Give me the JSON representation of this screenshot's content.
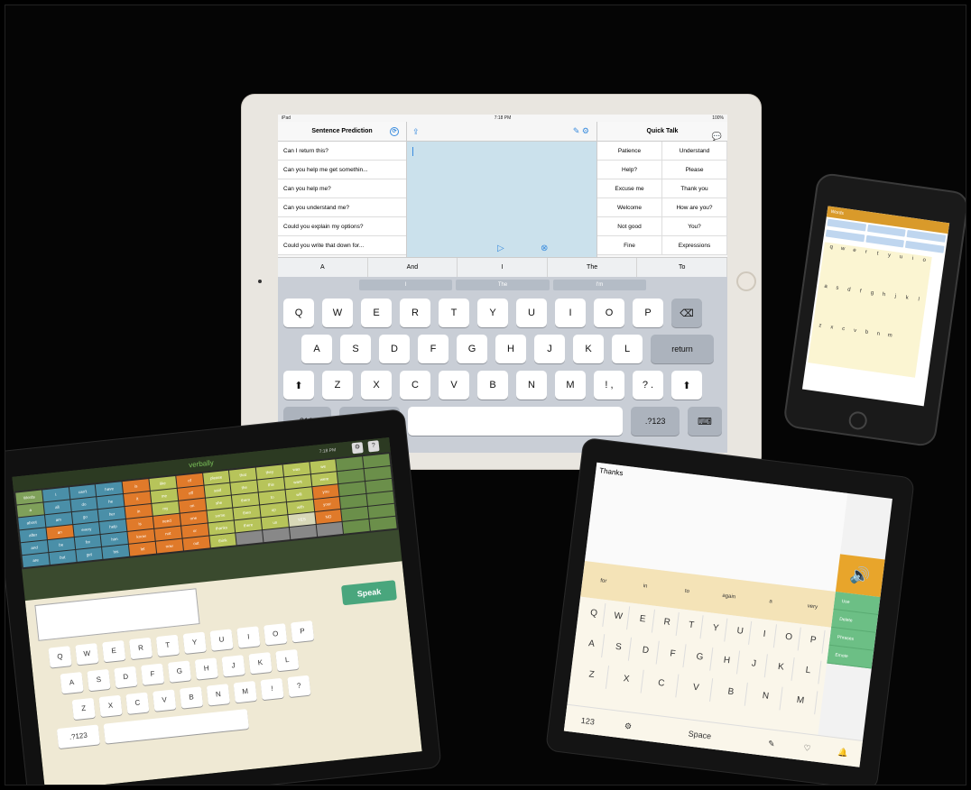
{
  "ipad": {
    "status": {
      "left": "iPad",
      "time": "7:18 PM",
      "battery": "100%"
    },
    "left_panel": {
      "title": "Sentence Prediction",
      "rows": [
        "Can I return this?",
        "Can you help me get somethin...",
        "Can you help me?",
        "Can you understand me?",
        "Could you explain my options?",
        "Could you write that down for..."
      ]
    },
    "right_panel": {
      "title": "Quick Talk",
      "cells": [
        "Patience",
        "Understand",
        "Help?",
        "Please",
        "Excuse me",
        "Thank you",
        "Welcome",
        "How are you?",
        "Not good",
        "You?",
        "Fine",
        "Expressions"
      ]
    },
    "prediction_bar": [
      "A",
      "And",
      "I",
      "The",
      "To"
    ],
    "suggestions": [
      "I",
      "The",
      "I'm"
    ],
    "keyboard": {
      "row1": [
        "Q",
        "W",
        "E",
        "R",
        "T",
        "Y",
        "U",
        "I",
        "O",
        "P"
      ],
      "row2": [
        "A",
        "S",
        "D",
        "F",
        "G",
        "H",
        "J",
        "K",
        "L"
      ],
      "return_label": "return",
      "row3": [
        "Z",
        "X",
        "C",
        "V",
        "B",
        "N",
        "M",
        "!\n,",
        "?\n."
      ],
      "num_label": ".?123"
    }
  },
  "phone": {
    "header": "Words",
    "keys": [
      "q",
      "w",
      "e",
      "r",
      "t",
      "y",
      "u",
      "i",
      "o",
      "a",
      "s",
      "d",
      "f",
      "g",
      "h",
      "j",
      "k",
      "l",
      "z",
      "x",
      "c",
      "v",
      "b",
      "n",
      "m",
      "",
      ""
    ]
  },
  "tablet_left": {
    "app_name": "verbally",
    "time": "7:18 PM",
    "speak_label": "Speak",
    "words": [
      {
        "t": "Words",
        "c": "#7fa05a"
      },
      {
        "t": "I",
        "c": "#4a8fa8"
      },
      {
        "t": "can't",
        "c": "#4a8fa8"
      },
      {
        "t": "have",
        "c": "#4a8fa8"
      },
      {
        "t": "is",
        "c": "#e07a2a"
      },
      {
        "t": "like",
        "c": "#b7c45a"
      },
      {
        "t": "of",
        "c": "#e07a2a"
      },
      {
        "t": "please",
        "c": "#b7c45a"
      },
      {
        "t": "that",
        "c": "#b7c45a"
      },
      {
        "t": "they",
        "c": "#b7c45a"
      },
      {
        "t": "was",
        "c": "#b7c45a"
      },
      {
        "t": "we",
        "c": "#b7c45a"
      },
      {
        "t": "",
        "c": "#6b8f4a"
      },
      {
        "t": "",
        "c": "#6b8f4a"
      },
      {
        "t": "a",
        "c": "#7fa05a"
      },
      {
        "t": "all",
        "c": "#4a8fa8"
      },
      {
        "t": "do",
        "c": "#4a8fa8"
      },
      {
        "t": "he",
        "c": "#4a8fa8"
      },
      {
        "t": "it",
        "c": "#e07a2a"
      },
      {
        "t": "me",
        "c": "#b7c45a"
      },
      {
        "t": "off",
        "c": "#e07a2a"
      },
      {
        "t": "said",
        "c": "#b7c45a"
      },
      {
        "t": "the",
        "c": "#b7c45a"
      },
      {
        "t": "this",
        "c": "#b7c45a"
      },
      {
        "t": "want",
        "c": "#b7c45a"
      },
      {
        "t": "were",
        "c": "#b7c45a"
      },
      {
        "t": "",
        "c": "#6b8f4a"
      },
      {
        "t": "",
        "c": "#6b8f4a"
      },
      {
        "t": "about",
        "c": "#4a8fa8"
      },
      {
        "t": "am",
        "c": "#4a8fa8"
      },
      {
        "t": "go",
        "c": "#4a8fa8"
      },
      {
        "t": "her",
        "c": "#4a8fa8"
      },
      {
        "t": "in",
        "c": "#e07a2a"
      },
      {
        "t": "my",
        "c": "#b7c45a"
      },
      {
        "t": "on",
        "c": "#e07a2a"
      },
      {
        "t": "she",
        "c": "#b7c45a"
      },
      {
        "t": "them",
        "c": "#b7c45a"
      },
      {
        "t": "to",
        "c": "#b7c45a"
      },
      {
        "t": "will",
        "c": "#b7c45a"
      },
      {
        "t": "you",
        "c": "#e07a2a"
      },
      {
        "t": "",
        "c": "#6b8f4a"
      },
      {
        "t": "",
        "c": "#6b8f4a"
      },
      {
        "t": "after",
        "c": "#4a8fa8"
      },
      {
        "t": "an",
        "c": "#e07a2a"
      },
      {
        "t": "every",
        "c": "#4a8fa8"
      },
      {
        "t": "help",
        "c": "#4a8fa8"
      },
      {
        "t": "is",
        "c": "#e07a2a"
      },
      {
        "t": "need",
        "c": "#e07a2a"
      },
      {
        "t": "one",
        "c": "#e07a2a"
      },
      {
        "t": "some",
        "c": "#b7c45a"
      },
      {
        "t": "then",
        "c": "#b7c45a"
      },
      {
        "t": "up",
        "c": "#b7c45a"
      },
      {
        "t": "with",
        "c": "#b7c45a"
      },
      {
        "t": "your",
        "c": "#e07a2a"
      },
      {
        "t": "",
        "c": "#6b8f4a"
      },
      {
        "t": "",
        "c": "#6b8f4a"
      },
      {
        "t": "and",
        "c": "#4a8fa8"
      },
      {
        "t": "be",
        "c": "#4a8fa8"
      },
      {
        "t": "for",
        "c": "#4a8fa8"
      },
      {
        "t": "him",
        "c": "#4a8fa8"
      },
      {
        "t": "know",
        "c": "#e07a2a"
      },
      {
        "t": "not",
        "c": "#e07a2a"
      },
      {
        "t": "or",
        "c": "#e07a2a"
      },
      {
        "t": "thanks",
        "c": "#b7c45a"
      },
      {
        "t": "there",
        "c": "#b7c45a"
      },
      {
        "t": "us",
        "c": "#b7c45a"
      },
      {
        "t": "YES",
        "c": "#d8d8b8"
      },
      {
        "t": "NO",
        "c": "#e07a2a"
      },
      {
        "t": "",
        "c": "#6b8f4a"
      },
      {
        "t": "",
        "c": "#6b8f4a"
      },
      {
        "t": "are",
        "c": "#4a8fa8"
      },
      {
        "t": "but",
        "c": "#4a8fa8"
      },
      {
        "t": "get",
        "c": "#4a8fa8"
      },
      {
        "t": "his",
        "c": "#4a8fa8"
      },
      {
        "t": "let",
        "c": "#e07a2a"
      },
      {
        "t": "now",
        "c": "#e07a2a"
      },
      {
        "t": "out",
        "c": "#e07a2a"
      },
      {
        "t": "think",
        "c": "#b7c45a"
      },
      {
        "t": "",
        "c": "#888"
      },
      {
        "t": "",
        "c": "#888"
      },
      {
        "t": "",
        "c": "#888"
      },
      {
        "t": "",
        "c": "#888"
      },
      {
        "t": "",
        "c": "#6b8f4a"
      },
      {
        "t": "",
        "c": "#6b8f4a"
      }
    ],
    "row1": [
      "Q",
      "W",
      "E",
      "R",
      "T",
      "Y",
      "U",
      "I",
      "O",
      "P"
    ],
    "row2": [
      "A",
      "S",
      "D",
      "F",
      "G",
      "H",
      "J",
      "K",
      "L"
    ],
    "row3": [
      "Z",
      "X",
      "C",
      "V",
      "B",
      "N",
      "M",
      "!",
      "?"
    ],
    "num_label": ".?123"
  },
  "tablet_right": {
    "text": "Thanks",
    "word_predictions": [
      "for",
      "in",
      "to",
      "again",
      "a",
      "very"
    ],
    "side_items": [
      "Use",
      "Delete",
      "Phrases",
      "Emote"
    ],
    "row1": [
      "Q",
      "W",
      "E",
      "R",
      "T",
      "Y",
      "U",
      "I",
      "O",
      "P"
    ],
    "row2": [
      "A",
      "S",
      "D",
      "F",
      "G",
      "H",
      "J",
      "K",
      "L"
    ],
    "row3": [
      "Z",
      "X",
      "C",
      "V",
      "B",
      "N",
      "M"
    ],
    "num_label": "123",
    "space_label": "Space"
  }
}
